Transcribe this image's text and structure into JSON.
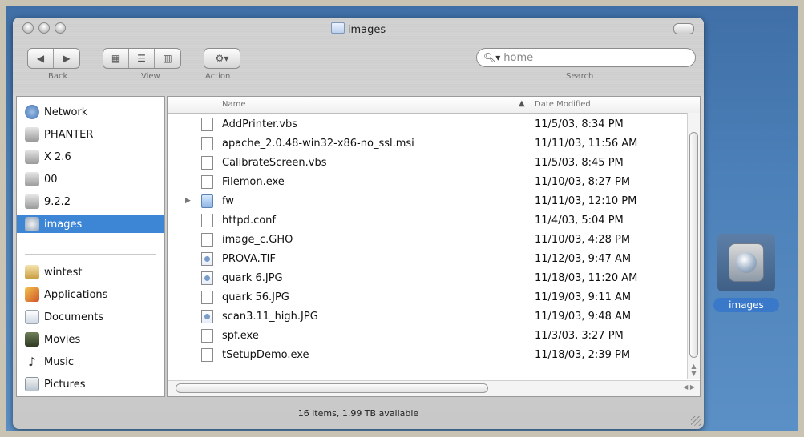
{
  "window": {
    "title": "images"
  },
  "toolbar": {
    "back_label": "Back",
    "view_label": "View",
    "action_label": "Action",
    "search_label": "Search",
    "search_value": "home"
  },
  "sidebar": {
    "items": [
      {
        "label": "Network",
        "icon": "globe-icon"
      },
      {
        "label": "PHANTER",
        "icon": "drive-icon"
      },
      {
        "label": "X 2.6",
        "icon": "drive-icon"
      },
      {
        "label": "00",
        "icon": "drive-icon"
      },
      {
        "label": "9.2.2",
        "icon": "drive-icon"
      },
      {
        "label": "images",
        "icon": "disk-image-icon",
        "selected": true
      },
      {
        "label": "wintest",
        "icon": "home-icon"
      },
      {
        "label": "Applications",
        "icon": "applications-icon"
      },
      {
        "label": "Documents",
        "icon": "documents-icon"
      },
      {
        "label": "Movies",
        "icon": "movies-icon"
      },
      {
        "label": "Music",
        "icon": "music-icon"
      },
      {
        "label": "Pictures",
        "icon": "pictures-icon"
      }
    ]
  },
  "list": {
    "columns": {
      "name": "Name",
      "date": "Date Modified"
    },
    "rows": [
      {
        "name": "AddPrinter.vbs",
        "date": "11/5/03, 8:34 PM",
        "kind": "file"
      },
      {
        "name": "apache_2.0.48-win32-x86-no_ssl.msi",
        "date": "11/11/03, 11:56 AM",
        "kind": "file"
      },
      {
        "name": "CalibrateScreen.vbs",
        "date": "11/5/03, 8:45 PM",
        "kind": "file"
      },
      {
        "name": "Filemon.exe",
        "date": "11/10/03, 8:27 PM",
        "kind": "file"
      },
      {
        "name": "fw",
        "date": "11/11/03, 12:10 PM",
        "kind": "folder"
      },
      {
        "name": "httpd.conf",
        "date": "11/4/03, 5:04 PM",
        "kind": "file"
      },
      {
        "name": "image_c.GHO",
        "date": "11/10/03, 4:28 PM",
        "kind": "file"
      },
      {
        "name": "PROVA.TIF",
        "date": "11/12/03, 9:47 AM",
        "kind": "image"
      },
      {
        "name": "quark 6.JPG",
        "date": "11/18/03, 11:20 AM",
        "kind": "image"
      },
      {
        "name": "quark 56.JPG",
        "date": "11/19/03, 9:11 AM",
        "kind": "file"
      },
      {
        "name": "scan3.11_high.JPG",
        "date": "11/19/03, 9:48 AM",
        "kind": "image"
      },
      {
        "name": "spf.exe",
        "date": "11/3/03, 3:27 PM",
        "kind": "file"
      },
      {
        "name": "tSetupDemo.exe",
        "date": "11/18/03, 2:39 PM",
        "kind": "file"
      }
    ]
  },
  "status": {
    "text": "16 items, 1.99 TB available"
  },
  "desktop": {
    "icon_label": "images"
  },
  "colors": {
    "selection": "#3d86d6",
    "desktop": "#4c80b8"
  }
}
